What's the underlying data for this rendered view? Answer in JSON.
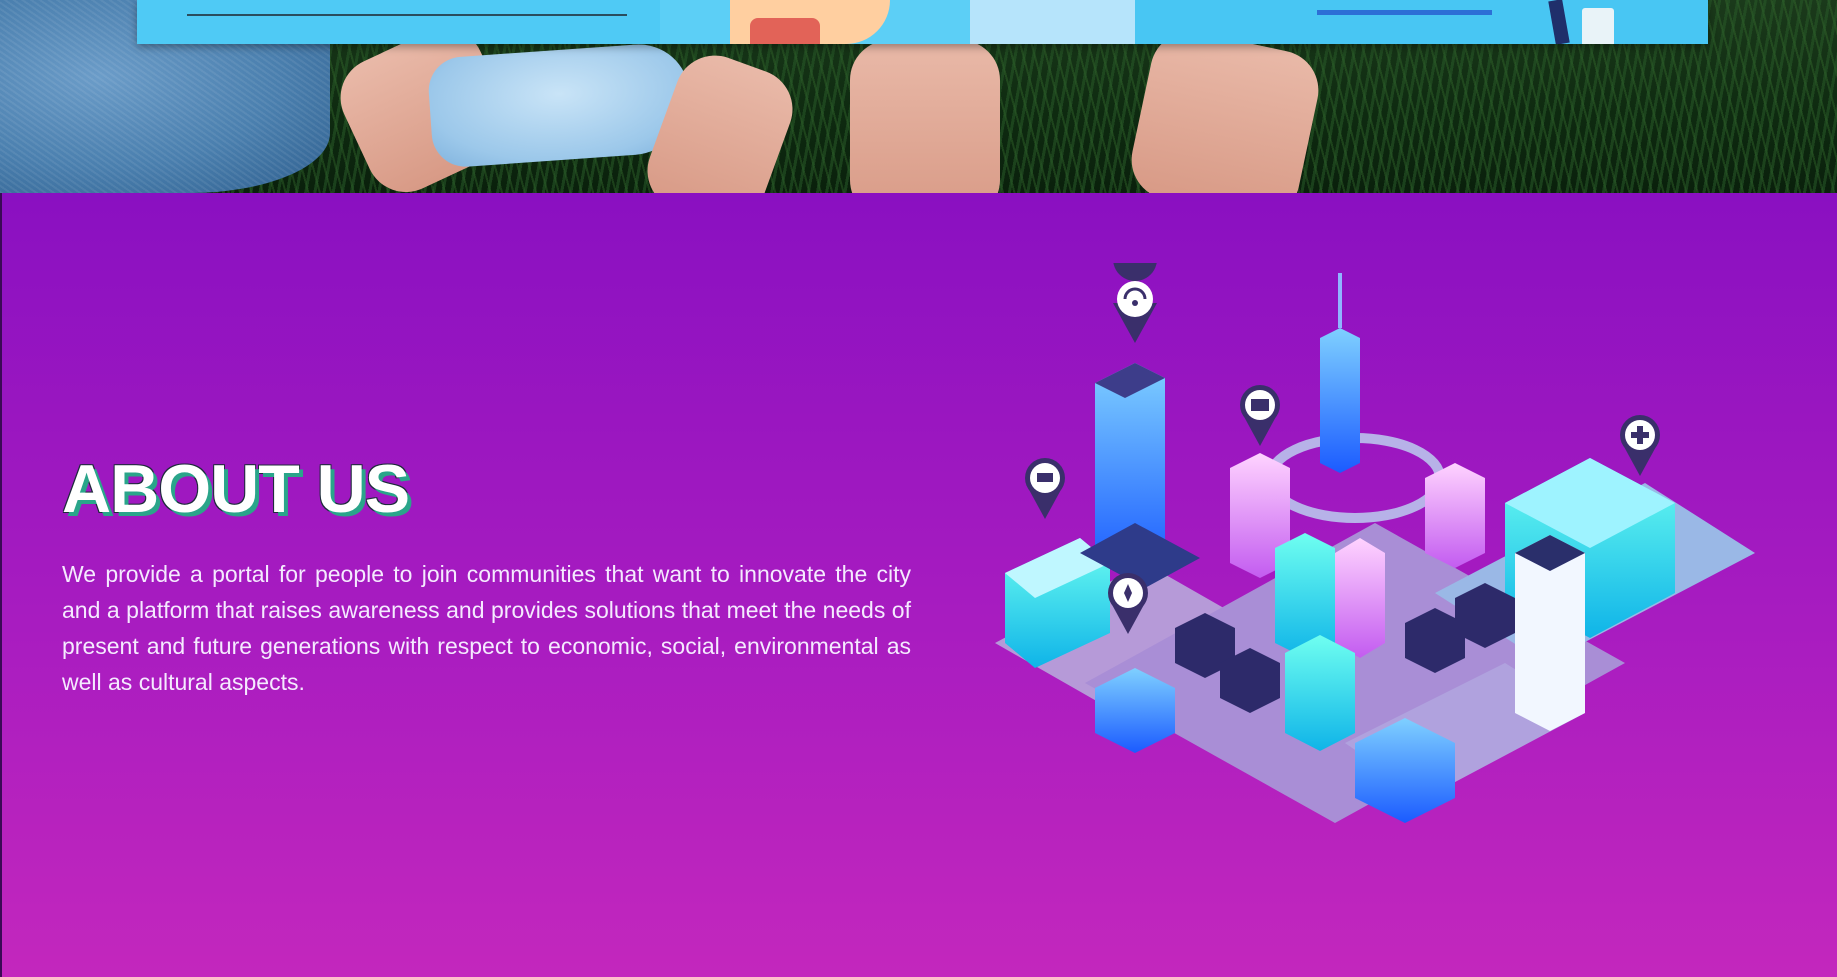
{
  "hero": {
    "image_alt": "Hands holding a tablet showing an illustrated online shopping scene"
  },
  "about": {
    "title": "ABOUT US",
    "body": "We provide a portal for people to join communities that want to innovate the city and a platform that raises awareness and provides solutions that meet the needs of present and future generations with respect to economic, social, environmental as well as cultural aspects.",
    "illustration": "isometric-smart-city",
    "map_pins": [
      "wifi-pin-icon",
      "bank-pin-icon",
      "cart-pin-icon",
      "police-pin-icon",
      "hospital-pin-icon"
    ]
  },
  "colors": {
    "section_top": "#8a10c1",
    "section_bottom": "#c327bd",
    "title_shadow": "#2aa58a",
    "tablet_screen": "#48c6f3"
  }
}
